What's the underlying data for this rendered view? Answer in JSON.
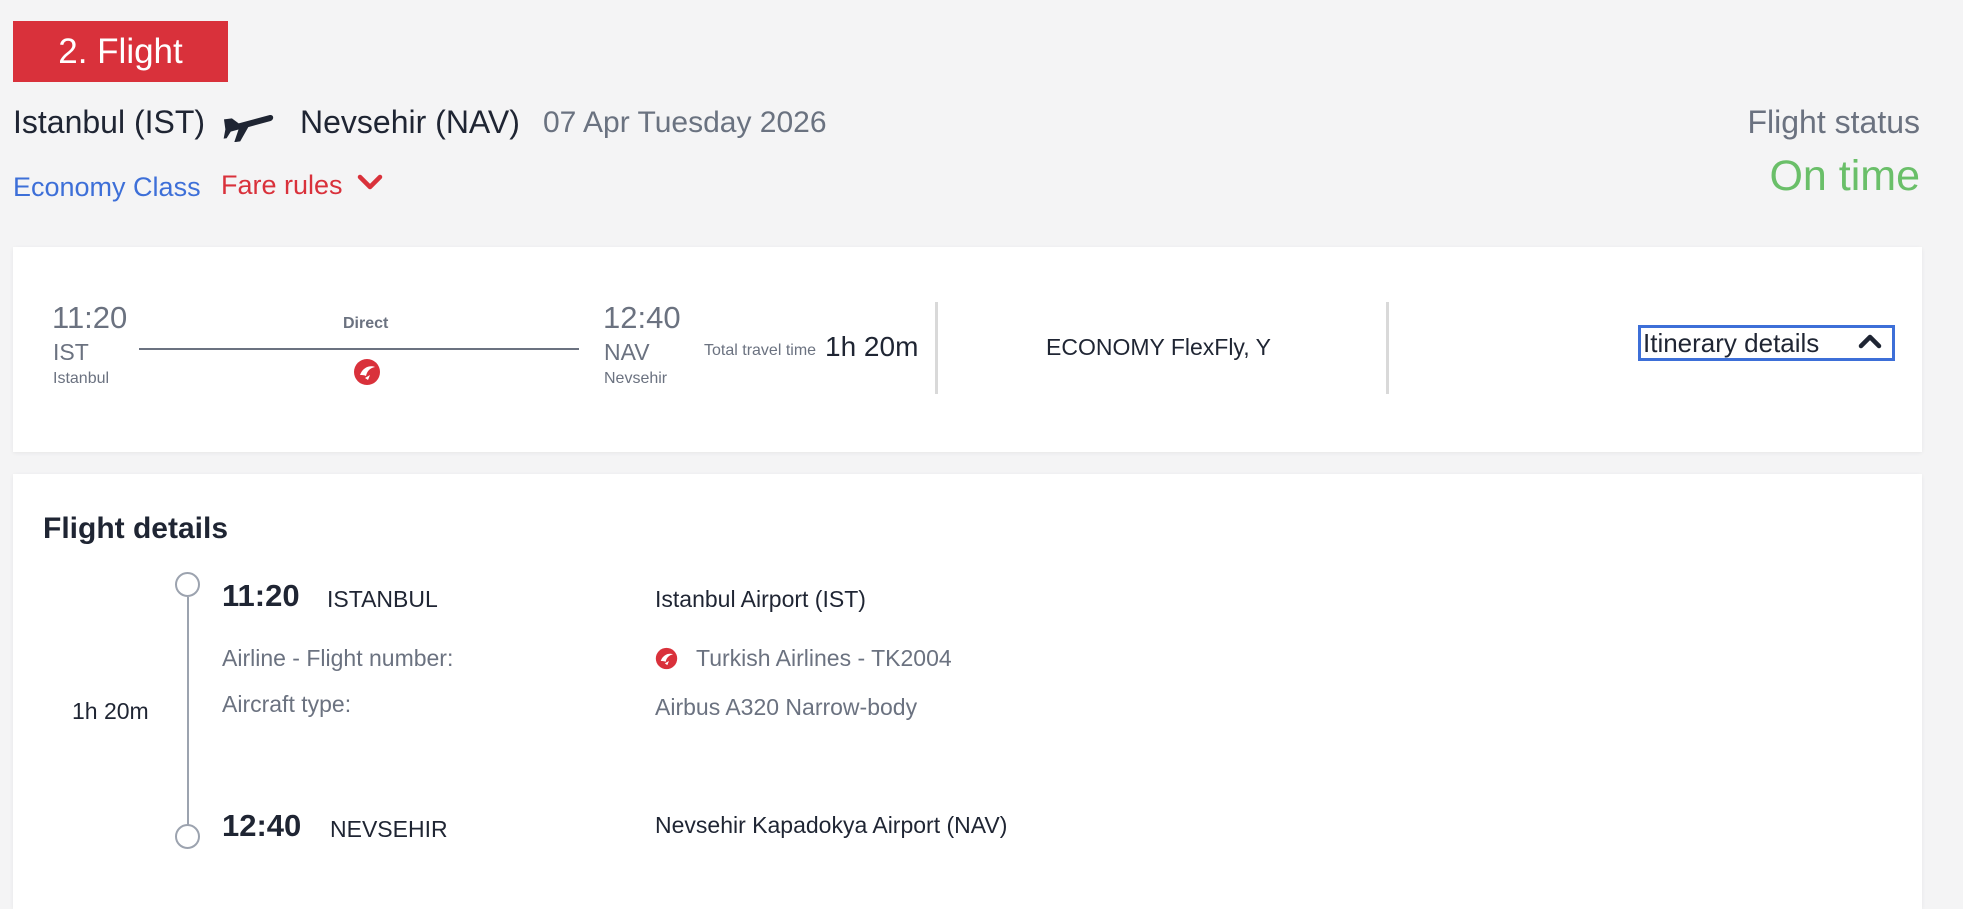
{
  "header": {
    "step_badge": "2. Flight",
    "origin": "Istanbul (IST)",
    "destination": "Nevsehir (NAV)",
    "date": "07 Apr Tuesday 2026",
    "cabin_class": "Economy Class",
    "fare_rules_label": "Fare rules",
    "flight_status_label": "Flight status",
    "flight_status_value": "On time"
  },
  "summary": {
    "departure_time": "11:20",
    "departure_code": "IST",
    "departure_city": "Istanbul",
    "stop_type": "Direct",
    "arrival_time": "12:40",
    "arrival_code": "NAV",
    "arrival_city": "Nevsehir",
    "total_travel_label": "Total travel time",
    "total_travel_value": "1h 20m",
    "fare_brand": "ECONOMY FlexFly, Y",
    "itinerary_details_label": "Itinerary details"
  },
  "details": {
    "title": "Flight details",
    "duration": "1h 20m",
    "departure": {
      "time": "11:20",
      "city": "ISTANBUL",
      "airport": "Istanbul Airport (IST)"
    },
    "airline_label": "Airline - Flight number:",
    "airline_value": "Turkish Airlines - TK2004",
    "aircraft_label": "Aircraft type:",
    "aircraft_value": "Airbus A320 Narrow-body",
    "arrival": {
      "time": "12:40",
      "city": "NEVSEHIR",
      "airport": "Nevsehir Kapadokya Airport (NAV)"
    }
  },
  "colors": {
    "brand_red": "#d9313b",
    "link_blue": "#3d6fd8",
    "status_green": "#6abf69",
    "focus_blue": "#3d6fd8"
  },
  "icons": {
    "route_plane": "airplane-icon",
    "fare_toggle": "chevron-down-icon",
    "itinerary_toggle": "chevron-up-icon",
    "airline_logo": "turkish-airlines-logo-icon"
  }
}
